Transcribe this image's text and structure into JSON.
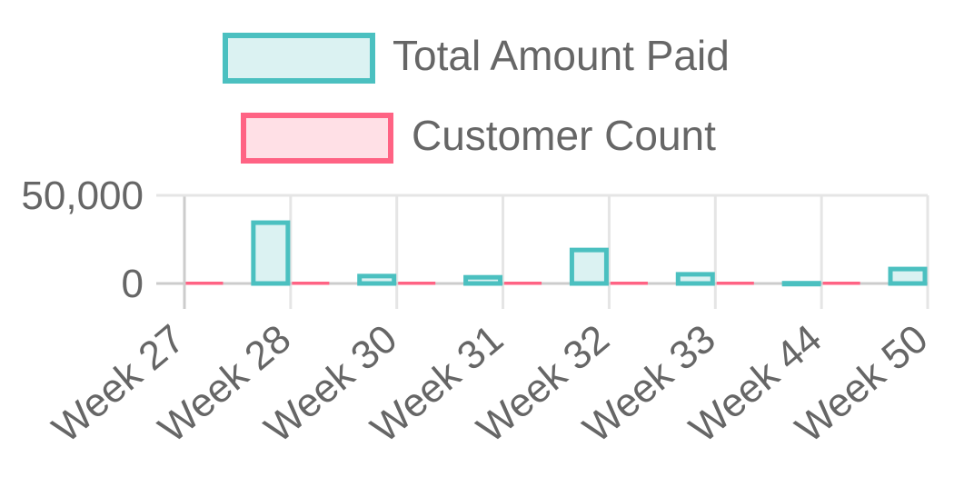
{
  "chart_data": {
    "type": "bar",
    "categories": [
      "Week 27",
      "Week 28",
      "Week 30",
      "Week 31",
      "Week 32",
      "Week 33",
      "Week 44",
      "Week 50"
    ],
    "series": [
      {
        "name": "Total Amount Paid",
        "values": [
          0,
          34500,
          4200,
          3500,
          19000,
          5200,
          150,
          8200
        ],
        "border_color": "#4bc0c0",
        "fill_color": "#dbf2f2"
      },
      {
        "name": "Customer Count",
        "values": [
          2,
          10,
          3,
          3,
          6,
          3,
          1,
          4
        ],
        "border_color": "#ff6384",
        "fill_color": "#ffe0e6"
      }
    ],
    "yticks": [
      0,
      50000
    ],
    "ytick_labels": [
      "0",
      "50,000"
    ],
    "ylim": [
      -15000,
      50000
    ],
    "legend_position": "top",
    "grid": true
  }
}
